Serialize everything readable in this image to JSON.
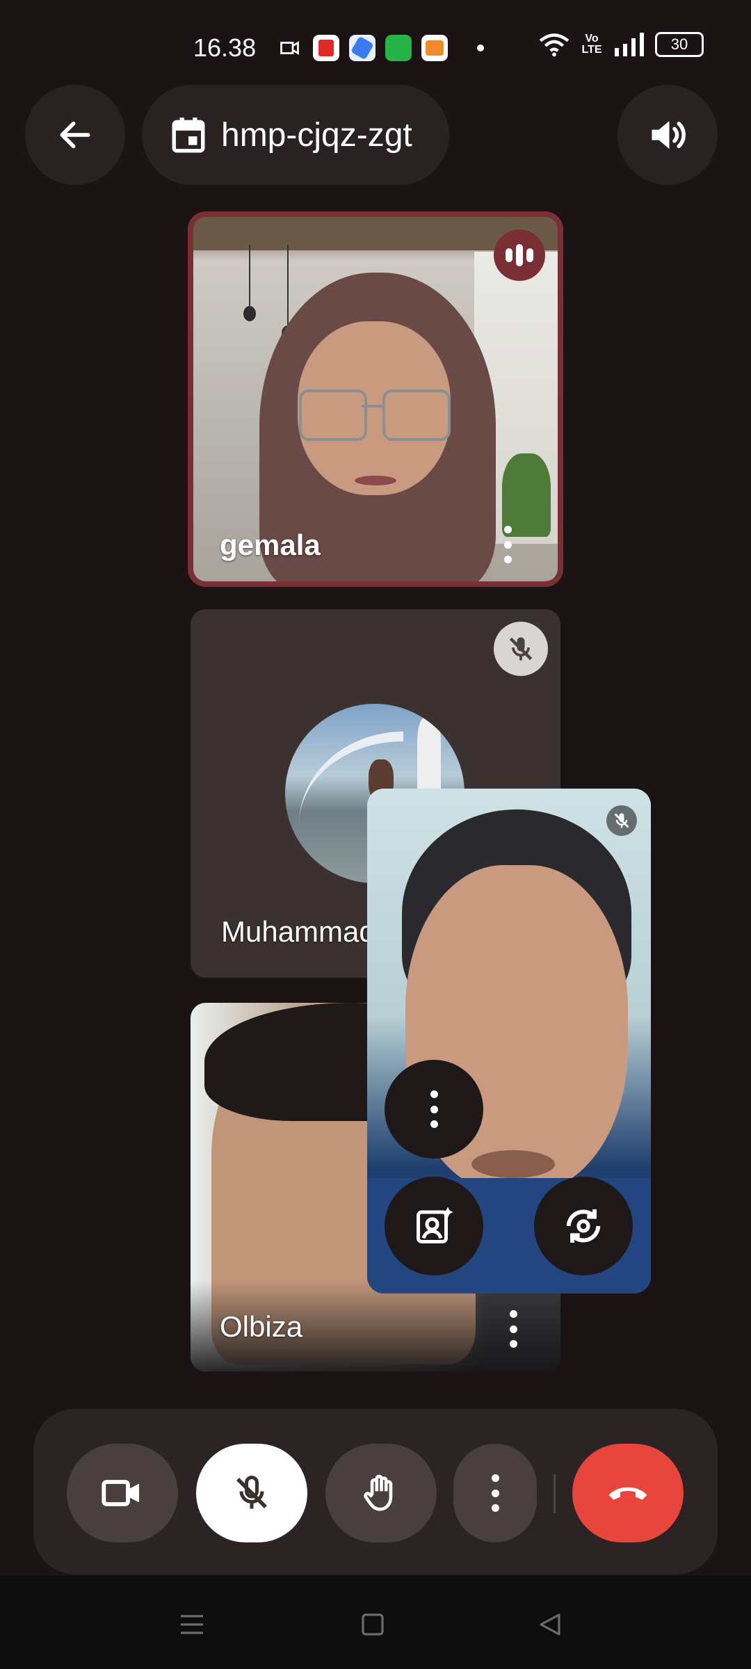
{
  "status_bar": {
    "time": "16.38",
    "battery": "30",
    "network": "Vo LTE"
  },
  "top_bar": {
    "meeting_code": "hmp-cjqz-zgt",
    "back_icon": "arrow-left-icon",
    "calendar_icon": "calendar-icon",
    "speaker_icon": "speaker-volume-icon"
  },
  "participants": [
    {
      "name": "gemala",
      "state": "speaking"
    },
    {
      "name": "Muhammad",
      "state": "muted, camera off"
    },
    {
      "name": "Olbiza",
      "state": "video on"
    }
  ],
  "self_view": {
    "state": "muted"
  },
  "controls": {
    "camera_icon": "video-camera-icon",
    "mic_icon": "mic-off-icon",
    "hand_icon": "raise-hand-icon",
    "more_icon": "more-vertical-icon",
    "end_call_icon": "end-call-icon"
  },
  "colors": {
    "background": "#1c1414",
    "speaking_border": "#7a2f35",
    "end_call": "#e8453c"
  }
}
